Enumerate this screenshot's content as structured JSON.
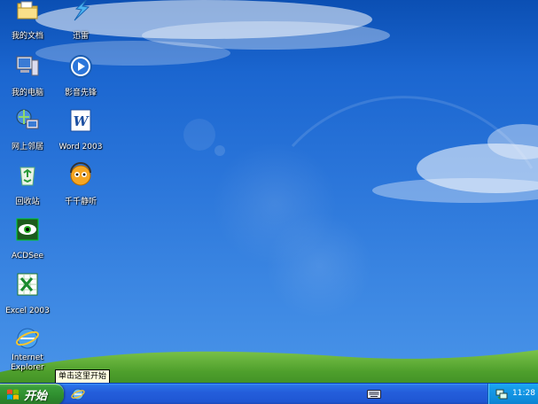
{
  "desktop": {
    "icons": [
      {
        "label": "我的文档",
        "icon": "folder-icon"
      },
      {
        "label": "迅雷",
        "icon": "thunder-icon"
      },
      {
        "label": "我的电脑",
        "icon": "computer-icon"
      },
      {
        "label": "影音先锋",
        "icon": "media-player-icon"
      },
      {
        "label": "网上邻居",
        "icon": "network-icon"
      },
      {
        "label": "Word 2003",
        "icon": "word-icon"
      },
      {
        "label": "回收站",
        "icon": "recycle-bin-icon"
      },
      {
        "label": "千千静听",
        "icon": "music-player-icon"
      },
      {
        "label": "ACDSee",
        "icon": "acdsee-icon"
      },
      {
        "label": "Excel 2003",
        "icon": "excel-icon"
      },
      {
        "label": "Internet Explorer",
        "icon": "ie-icon"
      }
    ]
  },
  "tooltip": {
    "text": "单击这里开始"
  },
  "taskbar": {
    "start_label": "开始",
    "clock": "11:28"
  },
  "colors": {
    "taskbar": "#245edb",
    "start_button": "#3a9e3a",
    "tray": "#0f8ede",
    "grass": "#4c9a2a"
  }
}
